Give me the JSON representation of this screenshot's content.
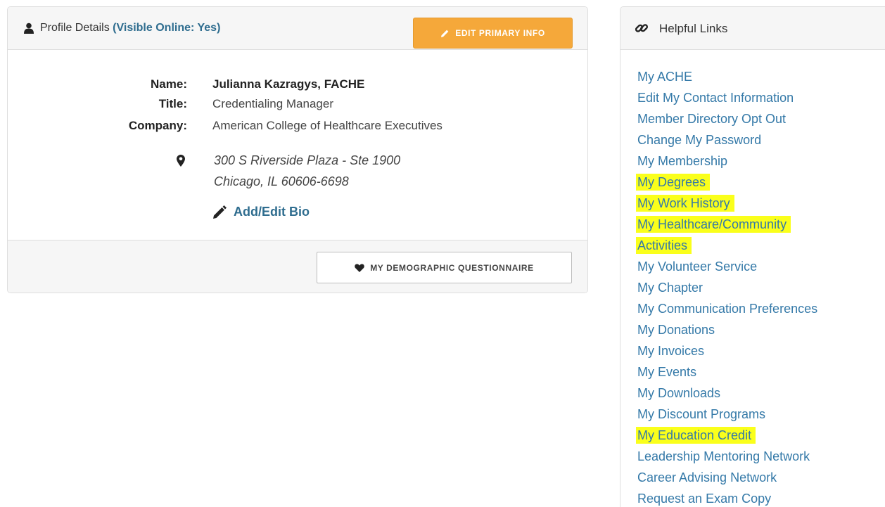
{
  "profile": {
    "header_title": "Profile Details",
    "visible_status": "(Visible Online: Yes)",
    "edit_primary_label": "EDIT PRIMARY INFO",
    "fields": {
      "name_label": "Name:",
      "name_value": "Julianna Kazragys, FACHE",
      "title_label": "Title:",
      "title_value": "Credentialing Manager",
      "company_label": "Company:",
      "company_value": "American College of Healthcare Executives"
    },
    "address": {
      "line1": "300 S Riverside Plaza - Ste 1900",
      "line2": "Chicago, IL 60606-6698"
    },
    "bio_link_label": "Add/Edit Bio",
    "demographic_label": "MY DEMOGRAPHIC QUESTIONNAIRE"
  },
  "helpful_links": {
    "title": "Helpful Links",
    "items": [
      {
        "label": "My ACHE",
        "highlighted": false
      },
      {
        "label": "Edit My Contact Information",
        "highlighted": false
      },
      {
        "label": "Member Directory Opt Out",
        "highlighted": false
      },
      {
        "label": "Change My Password",
        "highlighted": false
      },
      {
        "label": "My Membership",
        "highlighted": false
      },
      {
        "label": "My Degrees",
        "highlighted": true
      },
      {
        "label": "My Work History",
        "highlighted": true
      },
      {
        "label": "My Healthcare/Community",
        "highlighted": true
      },
      {
        "label": "Activities",
        "highlighted": true
      },
      {
        "label": "My Volunteer Service",
        "highlighted": false
      },
      {
        "label": "My Chapter",
        "highlighted": false
      },
      {
        "label": "My Communication Preferences",
        "highlighted": false
      },
      {
        "label": "My Donations",
        "highlighted": false
      },
      {
        "label": "My Invoices",
        "highlighted": false
      },
      {
        "label": "My Events",
        "highlighted": false
      },
      {
        "label": "My Downloads",
        "highlighted": false
      },
      {
        "label": "My Discount Programs",
        "highlighted": false
      },
      {
        "label": "My Education Credit",
        "highlighted": true
      },
      {
        "label": "Leadership Mentoring Network",
        "highlighted": false
      },
      {
        "label": "Career Advising Network",
        "highlighted": false
      },
      {
        "label": "Request an Exam Copy",
        "highlighted": false
      }
    ]
  },
  "colors": {
    "accent_orange": "#f5a83a",
    "link_blue": "#3479a8",
    "highlight_yellow": "#faff1b",
    "status_teal": "#2f6d8f"
  },
  "icons": {
    "profile_header": "person-icon",
    "edit_button": "pencil-icon",
    "address": "map-pin-icon",
    "bio": "pencil-icon",
    "demographic": "heart-icon",
    "links_header": "link-chain-icon"
  }
}
